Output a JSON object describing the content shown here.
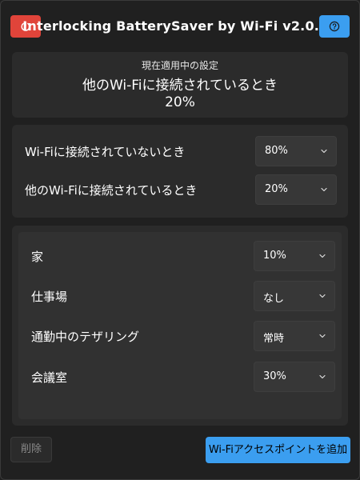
{
  "header": {
    "title": "Interlocking BatterySaver by Wi-Fi  v2.0.20",
    "power_icon": "power-icon",
    "help_icon": "help-icon",
    "power_color": "#e0443a",
    "accent_color": "#3b9ef0"
  },
  "current": {
    "label": "現在適用中の設定",
    "condition": "他のWi-Fiに接続されているとき",
    "value": "20%"
  },
  "general": {
    "rows": [
      {
        "label": "Wi-Fiに接続されていないとき",
        "value": "80%"
      },
      {
        "label": "他のWi-Fiに接続されているとき",
        "value": "20%"
      }
    ]
  },
  "networks": [
    {
      "label": "家",
      "value": "10%"
    },
    {
      "label": "仕事場",
      "value": "なし"
    },
    {
      "label": "通勤中のテザリング",
      "value": "常時"
    },
    {
      "label": "会議室",
      "value": "30%"
    }
  ],
  "footer": {
    "delete_label": "削除",
    "add_label": "Wi-Fiアクセスポイントを追加"
  }
}
